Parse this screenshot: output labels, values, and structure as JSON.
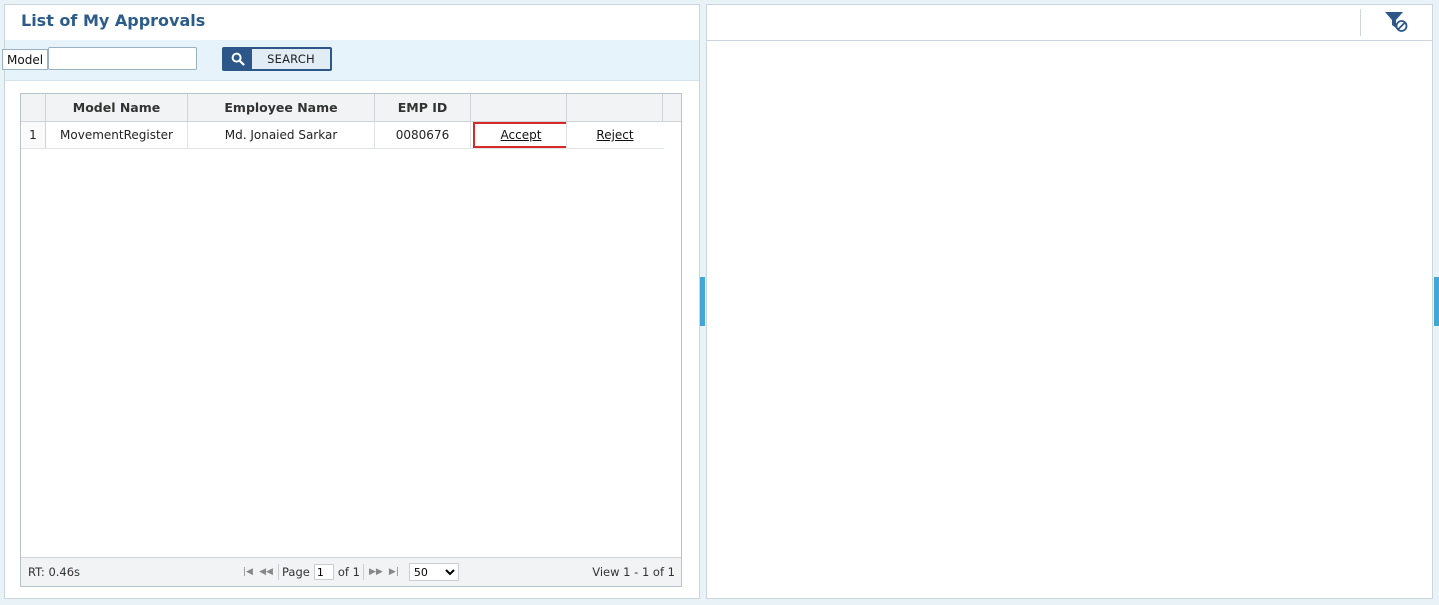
{
  "left_panel": {
    "title": "List of My Approvals",
    "search": {
      "model_label": "Model",
      "model_value": "",
      "button_label": "SEARCH"
    },
    "grid": {
      "columns": [
        "Model Name",
        "Employee Name",
        "EMP ID",
        "",
        ""
      ],
      "rows": [
        {
          "num": "1",
          "model_name": "MovementRegister",
          "employee_name": "Md. Jonaied Sarkar",
          "emp_id": "0080676",
          "accept": "Accept",
          "reject": "Reject"
        }
      ],
      "footer": {
        "rt": "RT: 0.46s",
        "page_label": "Page",
        "page_value": "1",
        "of_label": "of 1",
        "rows_per_page": "50",
        "view_info": "View 1 - 1 of 1"
      }
    }
  },
  "right_panel": {
    "filter_icon": "filter-clear-icon"
  },
  "colors": {
    "title": "#2c5d8a",
    "search_btn": "#2d5788",
    "accent_splitter": "#44a6d4",
    "highlight": "#d62a2a"
  }
}
